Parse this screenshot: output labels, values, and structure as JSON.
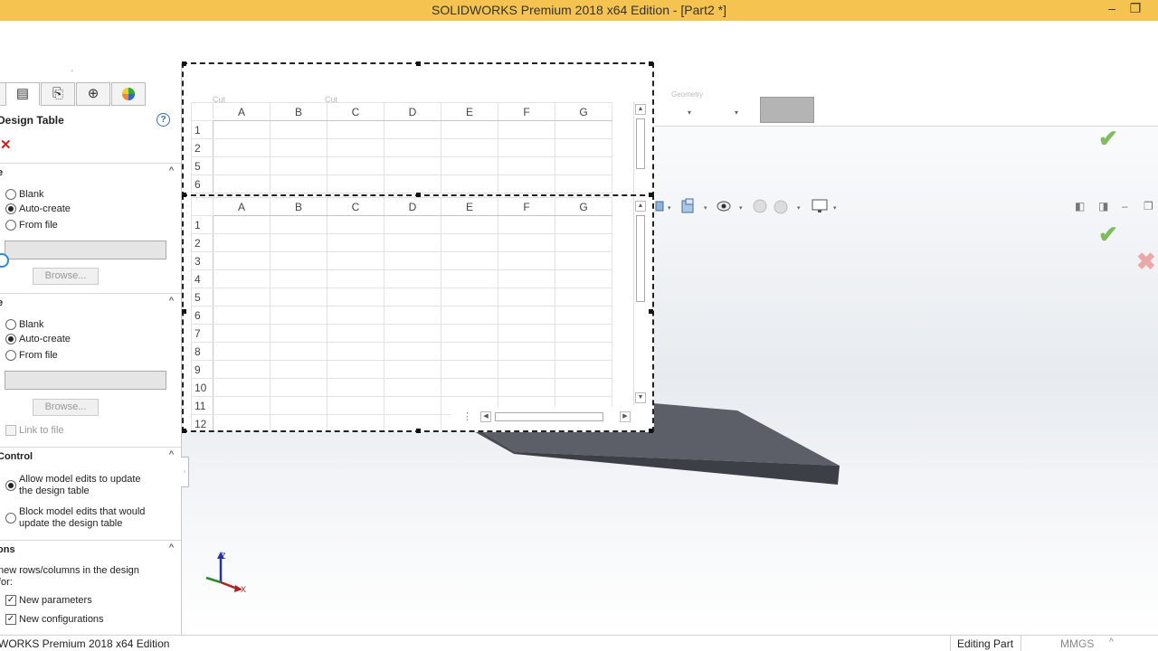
{
  "window": {
    "title": "SOLIDWORKS Premium 2018 x64 Edition - [Part2 *]",
    "minimize_glyph": "–",
    "restore_glyph": "❐"
  },
  "command_bar": {
    "ghost_labels": [
      "Cut",
      "Cut",
      "Geometry"
    ],
    "dropdown_glyph": "▾"
  },
  "view_toolbar": {
    "icons": [
      "view-orientation-icon",
      "display-style-icon",
      "hide-show-icon",
      "edit-appearance-icon",
      "apply-scene-icon",
      "view-settings-icon"
    ]
  },
  "panel": {
    "tab_icons": [
      "feature-manager-icon",
      "property-manager-icon",
      "configuration-manager-icon",
      "dimxpert-icon",
      "display-manager-icon"
    ],
    "title": "Design Table",
    "help_glyph": "?",
    "cancel_glyph": "✕",
    "source_section": {
      "title": "e",
      "collapse_glyph": "^",
      "options": [
        "Blank",
        "Auto-create",
        "From file"
      ],
      "selected": "Auto-create",
      "browse_label": "Browse..."
    },
    "source_section_2": {
      "title": "e",
      "collapse_glyph": "^",
      "options": [
        "Blank",
        "Auto-create",
        "From file"
      ],
      "selected": "Auto-create",
      "browse_label": "Browse...",
      "link_to_file_label": "Link to file"
    },
    "edit_control": {
      "title": "Control",
      "collapse_glyph": "^",
      "allow_line1": "Allow model edits to update",
      "allow_line2": "the design table",
      "block_line1": "Block model edits that would",
      "block_line2": "update the design table",
      "selected": "allow"
    },
    "options": {
      "title": "ons",
      "collapse_glyph": "^",
      "desc_line1": "new rows/columns in the design",
      "desc_line2": "for:",
      "new_parameters_label": "New parameters",
      "new_configurations_label": "New configurations",
      "check_glyph": "✓"
    }
  },
  "spreadsheet": {
    "columns": [
      "A",
      "B",
      "C",
      "D",
      "E",
      "F",
      "G"
    ],
    "top_rows": [
      "1",
      "2",
      "5",
      "6"
    ],
    "bottom_rows": [
      "1",
      "2",
      "3",
      "4",
      "5",
      "6",
      "7",
      "8",
      "9",
      "10",
      "11",
      "12"
    ],
    "scroll_up": "▲",
    "scroll_down": "▼",
    "scroll_left": "◀",
    "scroll_right": "▶",
    "split_glyph": "⋮"
  },
  "confirm": {
    "ok_glyph": "✔",
    "cancel_glyph": "✖"
  },
  "triad": {
    "z": "Z",
    "x": "X"
  },
  "status_bar": {
    "left_text": "WORKS Premium 2018 x64 Edition",
    "mode": "Editing Part",
    "units": "MMGS",
    "units_glyph": "^"
  }
}
